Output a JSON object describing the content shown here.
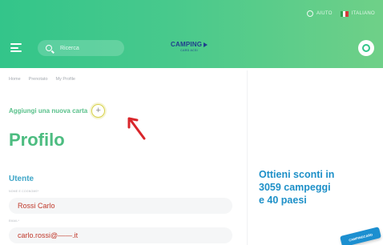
{
  "header": {
    "help_label": "AIUTO",
    "language_label": "ITALIANO",
    "search_placeholder": "Ricerca",
    "logo_text": "CAMPING",
    "logo_subtext": "CARD ACSI",
    "colors": {
      "gradient_start": "#33c58a",
      "gradient_end": "#6fd088",
      "logo": "#1f3e8c"
    }
  },
  "breadcrumb": [
    "Home",
    "Prenotato",
    "My Profile"
  ],
  "add_card": {
    "label": "Aggiungi una nuova carta",
    "button_symbol": "+"
  },
  "page_title": "Profilo",
  "section_title": "Utente",
  "fields": [
    {
      "label": "NOME E COGNOME*",
      "value": "Rossi Carlo"
    },
    {
      "label": "EMAIL*",
      "value": "carlo.rossi@——.it"
    }
  ],
  "promo": {
    "lines": [
      "Ottieni sconti in",
      "3059 campeggi",
      "e 40 paesi"
    ],
    "card_text": "CAMPINGCARD",
    "color": "#1e90c8"
  },
  "icons": [
    "globe-icon",
    "flag-icon",
    "menu-icon",
    "search-icon",
    "user-icon",
    "plus-icon",
    "arrow-annotation-icon"
  ]
}
